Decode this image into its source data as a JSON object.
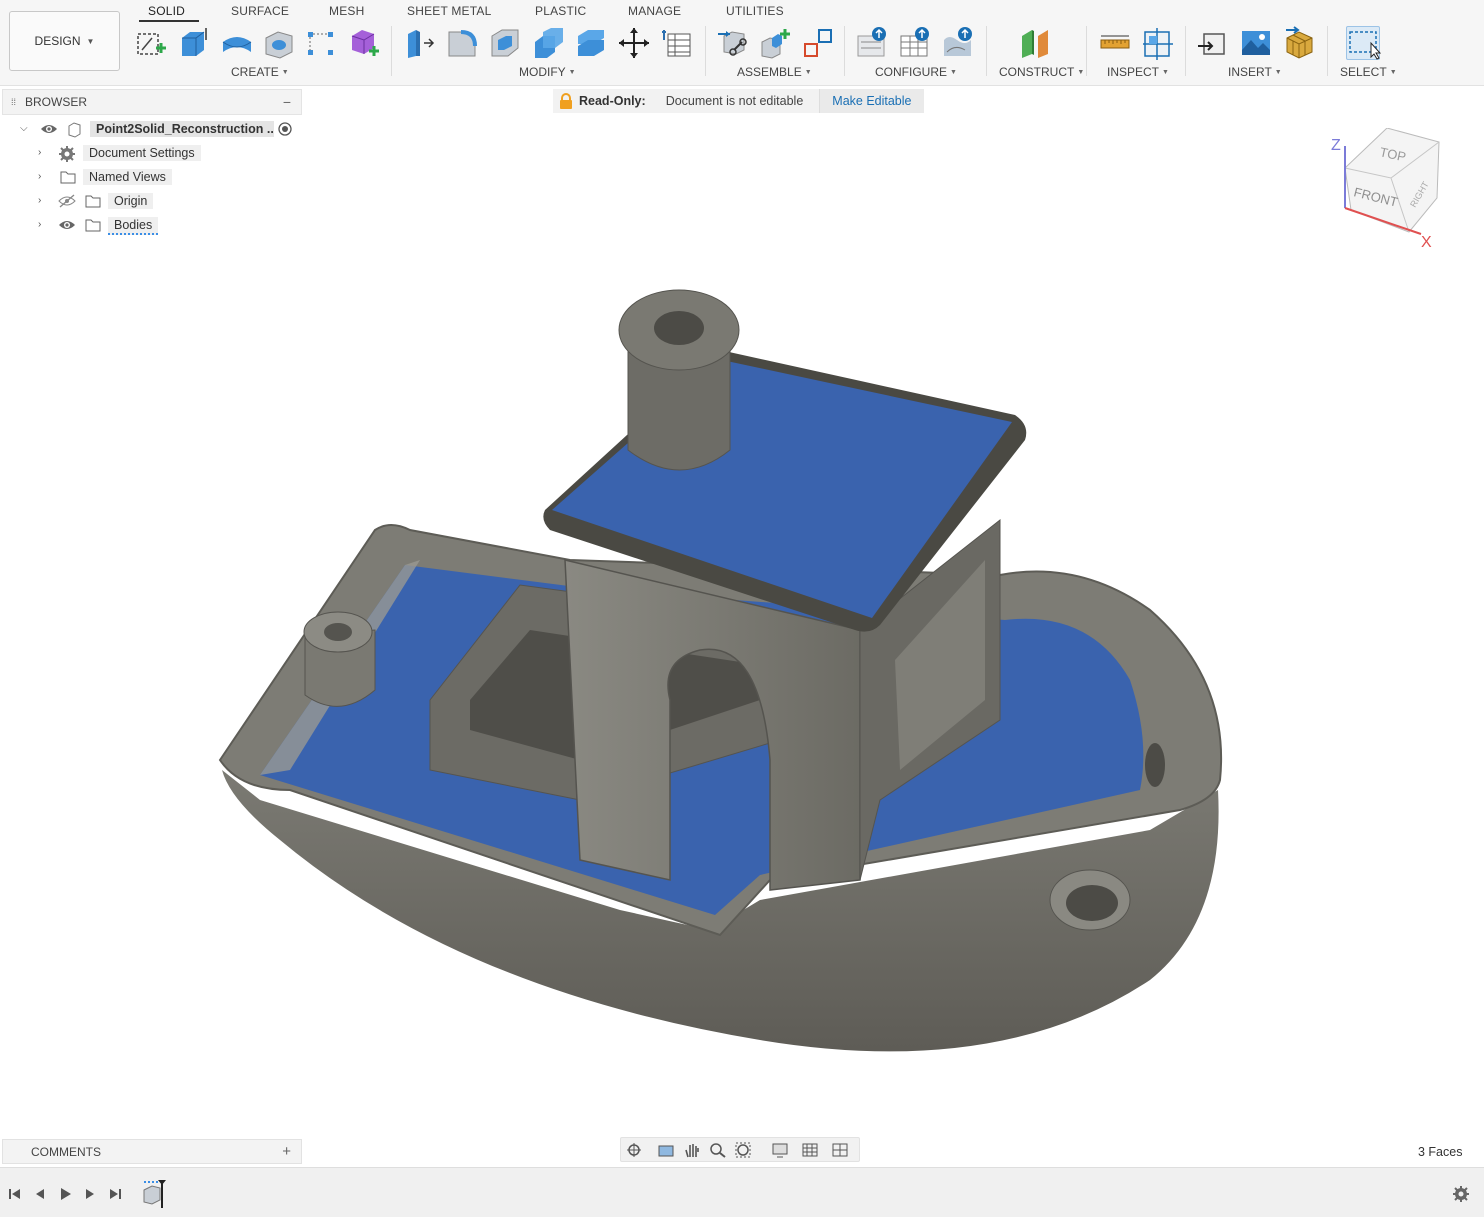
{
  "workspace": {
    "label": "DESIGN"
  },
  "tabs": [
    {
      "label": "SOLID",
      "active": true
    },
    {
      "label": "SURFACE"
    },
    {
      "label": "MESH"
    },
    {
      "label": "SHEET METAL"
    },
    {
      "label": "PLASTIC"
    },
    {
      "label": "MANAGE"
    },
    {
      "label": "UTILITIES"
    }
  ],
  "groups": {
    "create": "CREATE",
    "modify": "MODIFY",
    "assemble": "ASSEMBLE",
    "configure": "CONFIGURE",
    "construct": "CONSTRUCT",
    "inspect": "INSPECT",
    "insert": "INSERT",
    "select": "SELECT"
  },
  "browser": {
    "title": "BROWSER",
    "root": "Point2Solid_Reconstruction ...",
    "items": [
      {
        "label": "Document Settings",
        "icon": "gear-icon"
      },
      {
        "label": "Named Views",
        "icon": "folder-icon"
      },
      {
        "label": "Origin",
        "icon": "folder-icon",
        "visibility": "hidden"
      },
      {
        "label": "Bodies",
        "icon": "folder-icon",
        "visibility": "visible"
      }
    ]
  },
  "readonly": {
    "label": "Read-Only:",
    "message": "Document is not editable",
    "action": "Make Editable"
  },
  "viewcube": {
    "top": "TOP",
    "front": "FRONT",
    "right": "RIGHT",
    "axis_z": "Z",
    "axis_x": "X"
  },
  "comments": {
    "label": "COMMENTS"
  },
  "status": {
    "faces": "3 Faces"
  },
  "colors": {
    "body": "#6f6d66",
    "selected_face": "#3a63ae",
    "accent": "#1a6fb4"
  }
}
